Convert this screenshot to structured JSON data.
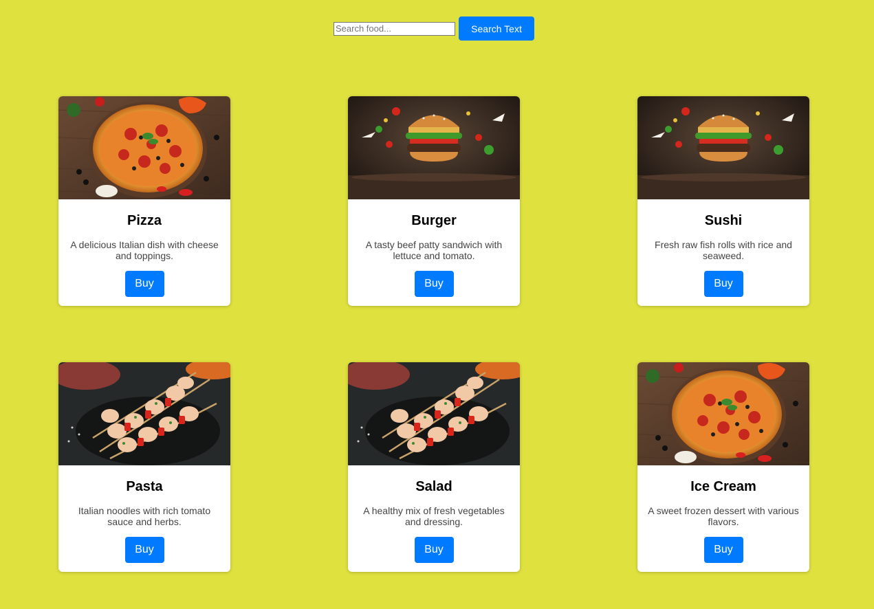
{
  "search": {
    "placeholder": "Search food...",
    "value": "",
    "button_label": "Search Text"
  },
  "colors": {
    "page_background": "#dfe13f",
    "accent": "#007bff",
    "card_background": "#ffffff"
  },
  "cards": [
    {
      "title": "Pizza",
      "description": "A delicious Italian dish with cheese and toppings.",
      "button_label": "Buy",
      "image": "pizza-photo"
    },
    {
      "title": "Burger",
      "description": "A tasty beef patty sandwich with lettuce and tomato.",
      "button_label": "Buy",
      "image": "burger-photo"
    },
    {
      "title": "Sushi",
      "description": "Fresh raw fish rolls with rice and seaweed.",
      "button_label": "Buy",
      "image": "burger-photo"
    },
    {
      "title": "Pasta",
      "description": "Italian noodles with rich tomato sauce and herbs.",
      "button_label": "Buy",
      "image": "skewers-photo"
    },
    {
      "title": "Salad",
      "description": "A healthy mix of fresh vegetables and dressing.",
      "button_label": "Buy",
      "image": "skewers-photo"
    },
    {
      "title": "Ice Cream",
      "description": "A sweet frozen dessert with various flavors.",
      "button_label": "Buy",
      "image": "pizza-photo"
    }
  ]
}
